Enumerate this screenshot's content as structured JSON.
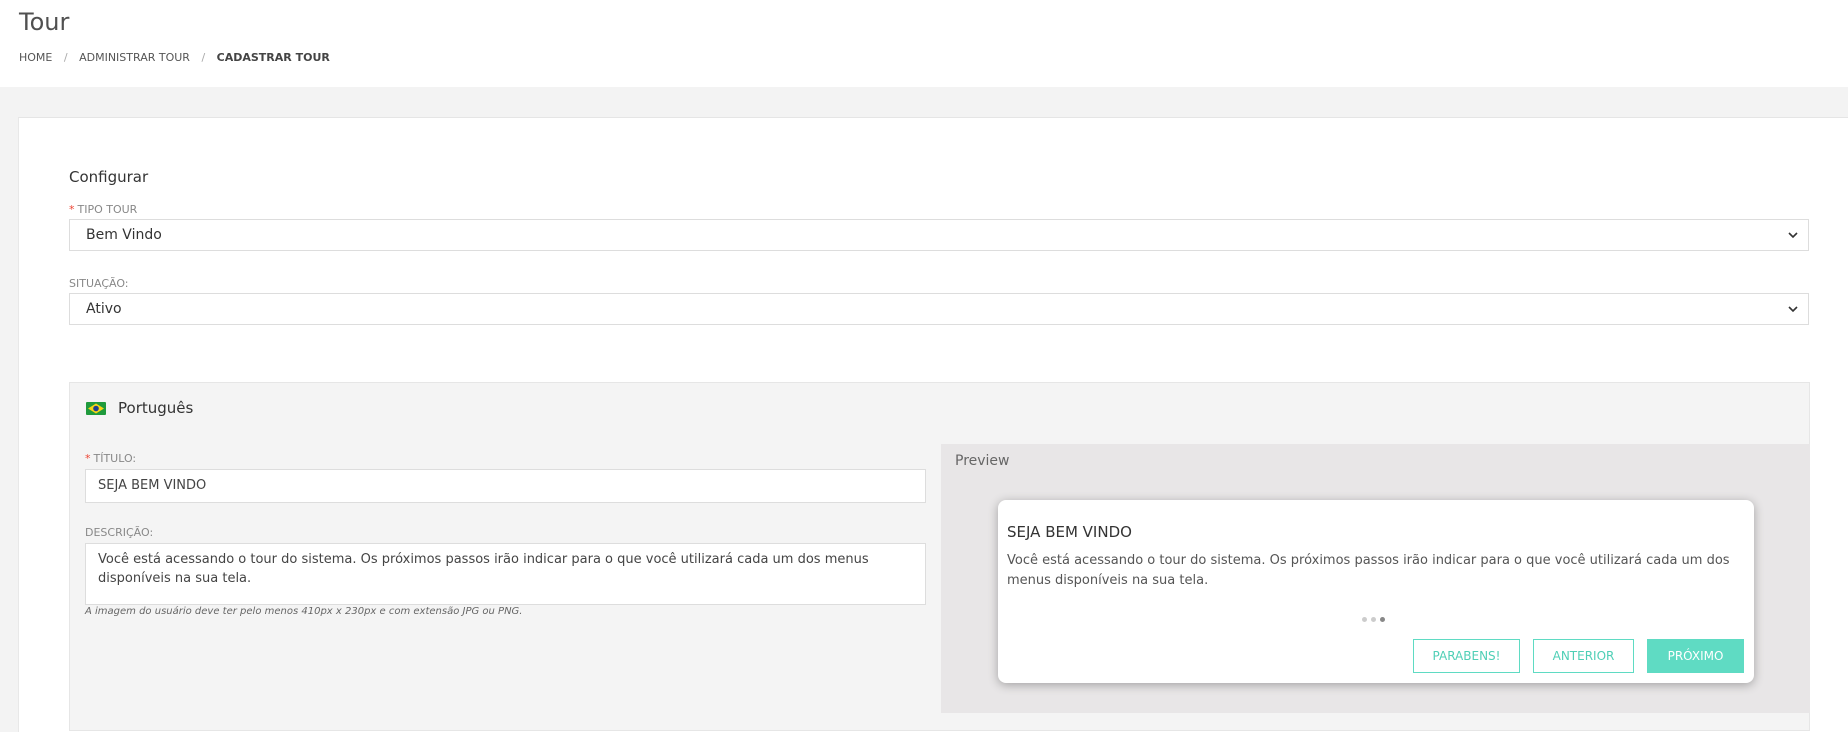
{
  "header": {
    "title": "Tour",
    "breadcrumb": [
      "HOME",
      "ADMINISTRAR TOUR",
      "CADASTRAR TOUR"
    ],
    "separator": "/"
  },
  "config": {
    "section_title": "Configurar",
    "required_mark": "*",
    "tipo_tour": {
      "label": "TIPO TOUR",
      "value": "Bem Vindo"
    },
    "situacao": {
      "label": "SITUAÇÃO:",
      "value": "Ativo"
    }
  },
  "language": {
    "name": "Português",
    "flag_icon": "brazil-flag-icon",
    "titulo": {
      "label": "TÍTULO:",
      "value": "SEJA BEM VINDO"
    },
    "descricao": {
      "label": "DESCRIÇÃO:",
      "value": "Você está acessando o tour do sistema. Os próximos passos irão indicar para o que você utilizará cada um dos menus disponíveis na sua tela."
    },
    "hint": "A imagem do usuário deve ter pelo menos 410px x 230px e com extensão JPG ou PNG."
  },
  "preview": {
    "label": "Preview",
    "title": "SEJA BEM VINDO",
    "description": "Você está acessando o tour do sistema. Os próximos passos irão indicar para o que você utilizará cada um dos menus disponíveis na sua tela.",
    "step_total": 3,
    "step_current": 3,
    "buttons": {
      "finish": "PARABENS!",
      "prev": "ANTERIOR",
      "next": "PRÓXIMO"
    }
  },
  "colors": {
    "accent": "#5fdbc3",
    "required": "#e43"
  }
}
